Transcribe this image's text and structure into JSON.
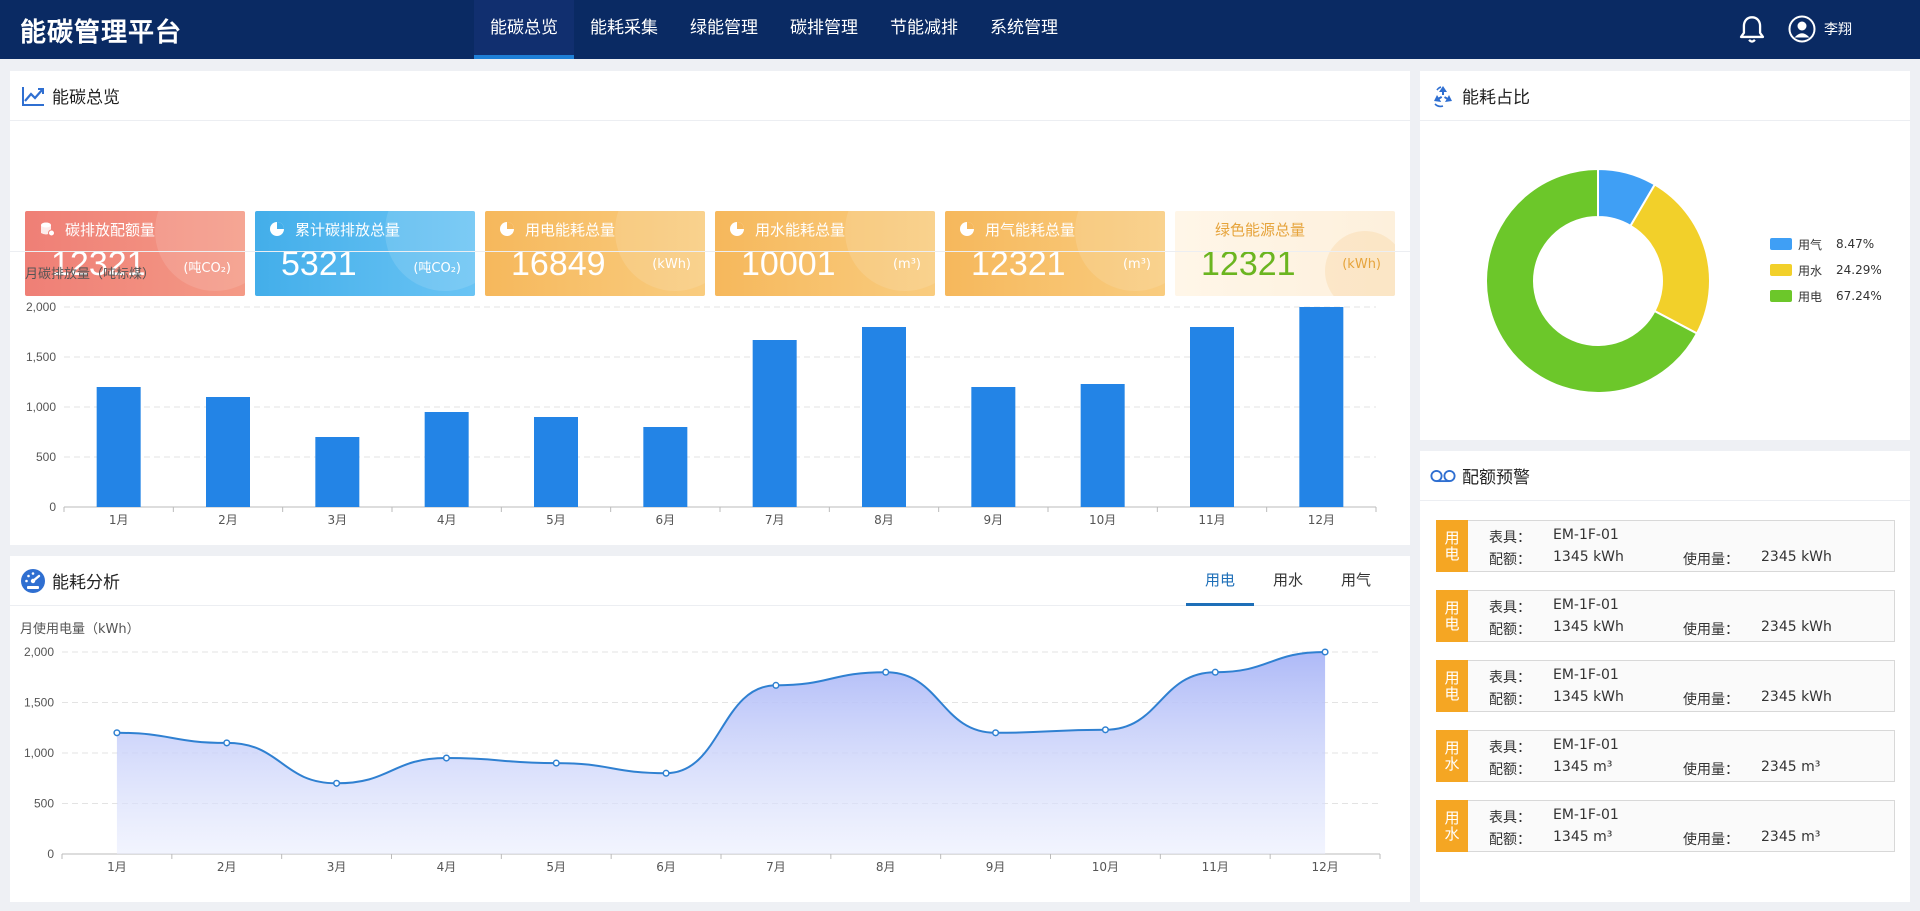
{
  "app": {
    "title": "能碳管理平台",
    "user_name": "李翔"
  },
  "nav": [
    {
      "label": "能碳总览",
      "active": true
    },
    {
      "label": "能耗采集",
      "active": false
    },
    {
      "label": "绿能管理",
      "active": false
    },
    {
      "label": "碳排管理",
      "active": false
    },
    {
      "label": "节能减排",
      "active": false
    },
    {
      "label": "系统管理",
      "active": false
    }
  ],
  "overview": {
    "title": "能碳总览",
    "cards": [
      {
        "label": "碳排放配额量",
        "value": "12321",
        "unit": "(吨CO₂)",
        "color": "#f08478"
      },
      {
        "label": "累计碳排放总量",
        "value": "5321",
        "unit": "(吨CO₂)",
        "color": "#4db5ee"
      },
      {
        "label": "用电能耗总量",
        "value": "16849",
        "unit": "(kWh)",
        "color": "#f7be67"
      },
      {
        "label": "用水能耗总量",
        "value": "10001",
        "unit": "(m³)",
        "color": "#f7be67"
      },
      {
        "label": "用气能耗总量",
        "value": "12321",
        "unit": "(m³)",
        "color": "#f7be67"
      },
      {
        "label": "绿色能源总量",
        "value": "12321",
        "unit": "(kWh)",
        "color": "#fff4e3"
      }
    ]
  },
  "chart_data": [
    {
      "type": "bar",
      "title": "",
      "ylabel": "月碳排放量（吨标煤）",
      "categories": [
        "1月",
        "2月",
        "3月",
        "4月",
        "5月",
        "6月",
        "7月",
        "8月",
        "9月",
        "10月",
        "11月",
        "12月"
      ],
      "values": [
        1200,
        1100,
        700,
        950,
        900,
        800,
        1670,
        1800,
        1200,
        1230,
        1800,
        2000
      ],
      "ylim": [
        0,
        2000
      ],
      "yticks": [
        "0",
        "500",
        "1,000",
        "1,500",
        "2,000"
      ],
      "grid": true,
      "color": "#2384e6"
    },
    {
      "type": "area",
      "title": "",
      "ylabel": "月使用电量（kWh）",
      "categories": [
        "1月",
        "2月",
        "3月",
        "4月",
        "5月",
        "6月",
        "7月",
        "8月",
        "9月",
        "10月",
        "11月",
        "12月"
      ],
      "values": [
        1200,
        1100,
        700,
        950,
        900,
        800,
        1670,
        1800,
        1200,
        1230,
        1800,
        2000
      ],
      "ylim": [
        0,
        2000
      ],
      "yticks": [
        "0",
        "500",
        "1,000",
        "1,500",
        "2,000"
      ],
      "grid": true,
      "color": "#2f80d1"
    },
    {
      "type": "pie",
      "title": "",
      "series": [
        {
          "name": "用气",
          "value": 8.47,
          "label": "8.47%",
          "color": "#3f9ff5"
        },
        {
          "name": "用水",
          "value": 24.29,
          "label": "24.29%",
          "color": "#f2d02a"
        },
        {
          "name": "用电",
          "value": 67.24,
          "label": "67.24%",
          "color": "#6cc72a"
        }
      ],
      "legend": "right"
    }
  ],
  "analysis": {
    "title": "能耗分析",
    "tabs": [
      {
        "label": "用电",
        "active": true
      },
      {
        "label": "用水",
        "active": false
      },
      {
        "label": "用气",
        "active": false
      }
    ]
  },
  "ratio": {
    "title": "能耗占比"
  },
  "quota": {
    "title": "配额预警",
    "meter_label": "表具：",
    "quota_label": "配额：",
    "usage_label": "使用量：",
    "items": [
      {
        "tag": [
          "用",
          "电"
        ],
        "meter": "EM-1F-01",
        "quota": "1345 kWh",
        "usage": "2345 kWh"
      },
      {
        "tag": [
          "用",
          "电"
        ],
        "meter": "EM-1F-01",
        "quota": "1345 kWh",
        "usage": "2345 kWh"
      },
      {
        "tag": [
          "用",
          "电"
        ],
        "meter": "EM-1F-01",
        "quota": "1345 kWh",
        "usage": "2345 kWh"
      },
      {
        "tag": [
          "用",
          "水"
        ],
        "meter": "EM-1F-01",
        "quota": "1345 m³",
        "usage": "2345 m³"
      },
      {
        "tag": [
          "用",
          "水"
        ],
        "meter": "EM-1F-01",
        "quota": "1345 m³",
        "usage": "2345 m³"
      }
    ]
  }
}
